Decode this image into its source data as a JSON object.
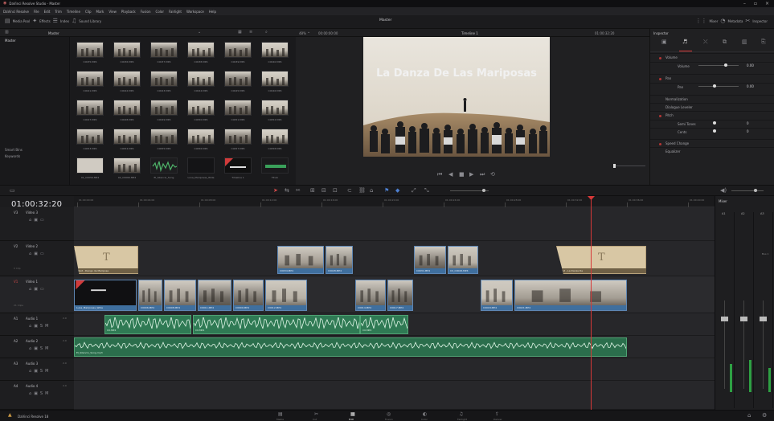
{
  "app": {
    "title": "DaVinci Resolve Studio - Master",
    "brand": "DaVinci Resolve 18"
  },
  "menu": [
    "DaVinci Resolve",
    "File",
    "Edit",
    "Trim",
    "Timeline",
    "Clip",
    "Mark",
    "View",
    "Playback",
    "Fusion",
    "Color",
    "Fairlight",
    "Workspace",
    "Help"
  ],
  "toolbar": {
    "media_pool": "Media Pool",
    "effects": "Effects",
    "edit_index": "Index",
    "sound_library": "Sound Library",
    "page_title": "Master",
    "timeline_name": "Timeline 1",
    "mixer": "Mixer",
    "metadata": "Metadata",
    "inspector": "Inspector"
  },
  "mediapool": {
    "bin_header": "Master",
    "bins": [
      "Master",
      "Smart Bins",
      "Keywords"
    ]
  },
  "clips": [
    "C0035.MP4",
    "C0036.MP4",
    "C0037.MP4",
    "C0038.MP4",
    "C0039.MP4",
    "C0040.MP4",
    "C0041.MP4",
    "C0042.MP4",
    "C0043.MP4",
    "C0044.MP4",
    "C0045.MP4",
    "C0046.MP4",
    "C0047.MP4",
    "C0048.MP4",
    "C0049.MP4",
    "C0050.MP4",
    "C0051.MP4",
    "C0052.MP4",
    "C0053.MP4",
    "C0054.MP4",
    "C0055.MP4",
    "C0056.MP4",
    "C0057.MP4",
    "C0058.MP4",
    "01_C0059.MP4",
    "02_C0060.MP4",
    "El_Silencio_Song",
    "Luna_Mariposas_Wide",
    "Timeline 1",
    "Titulo"
  ],
  "viewer": {
    "zoom": "48%",
    "tc_left": "00:00:00:00",
    "overlay_title": "La Danza De Las Mariposas",
    "tc_right": "01:00:32:20"
  },
  "inspector": {
    "header": "Inspector",
    "tabs": [
      "Video",
      "Audio",
      "Effects",
      "Transition",
      "Image",
      "File"
    ],
    "rows": [
      "Volume",
      "Volume",
      "Pan",
      "Pan",
      "Normalization",
      "Dialogue Leveler",
      "Pitch",
      "Semi Tones",
      "Cents",
      "Speed Change",
      "Equalizer"
    ],
    "values": {
      "volume": "0.00",
      "pan": "0.00",
      "semitones": "0",
      "cents": "0"
    }
  },
  "timeline": {
    "timecode": "01:00:32:20",
    "ruler": [
      "01:00:00:00",
      "01:00:04:00",
      "01:00:08:00",
      "01:00:12:00",
      "01:00:16:00",
      "01:00:20:00",
      "01:00:24:00",
      "01:00:28:00",
      "01:00:32:00",
      "01:00:36:00",
      "01:00:40:00"
    ],
    "tracks": [
      {
        "id": "V3",
        "name": "Video 3",
        "clips": ""
      },
      {
        "id": "V2",
        "name": "Video 2",
        "clips": "0 Clip"
      },
      {
        "id": "V1",
        "name": "Video 1",
        "clips": "21 Clips"
      },
      {
        "id": "A1",
        "name": "Audio 1",
        "level": "2.0"
      },
      {
        "id": "A2",
        "name": "Audio 2",
        "level": "2.0"
      },
      {
        "id": "A3",
        "name": "Audio 3",
        "level": "2.0"
      },
      {
        "id": "A4",
        "name": "Audio 4",
        "level": "2.0"
      }
    ],
    "v2_clips": [
      {
        "label": "Text - Dango de Mariposa",
        "type": "title"
      },
      {
        "label": "C0034.MP4"
      },
      {
        "label": "C0028.MP4"
      },
      {
        "label": "C0031.MP4"
      },
      {
        "label": "C0_C0026.MP4"
      },
      {
        "label": "Text - La Danza De",
        "type": "title"
      }
    ],
    "v1_clips": [
      "Luna_Mariposas_Wide",
      "C0006.MP4",
      "C0008.MP4",
      "C0011.MP4",
      "C0009.MP4",
      "C0012.MP4",
      "C0014.MP4",
      "C0017.MP4",
      "C0018.MP4",
      "C0021.MP4"
    ],
    "a1_clips": [
      "C0.MP4",
      "C0.MP4",
      "C0.MP4"
    ],
    "a2_clip": "El_Silencio_Song.mp3"
  },
  "mixer": {
    "title": "Mixer",
    "strips": [
      "A1",
      "A2",
      "A3"
    ],
    "main": "Bus 1",
    "meters": [
      0.35,
      0.4,
      0.3
    ],
    "accent": "#d73838"
  },
  "bottom": {
    "pages": [
      "Media",
      "Cut",
      "Edit",
      "Fusion",
      "Color",
      "Fairlight",
      "Deliver"
    ],
    "active": "Edit"
  }
}
